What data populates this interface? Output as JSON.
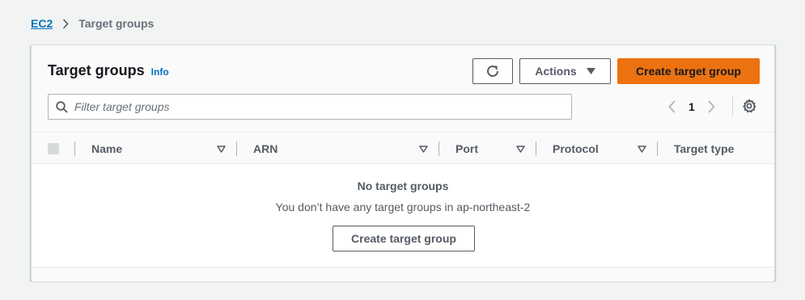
{
  "breadcrumb": {
    "root": "EC2",
    "current": "Target groups"
  },
  "header": {
    "title": "Target groups",
    "info": "Info",
    "actions_label": "Actions",
    "create_label": "Create target group"
  },
  "search": {
    "placeholder": "Filter target groups",
    "value": ""
  },
  "pagination": {
    "page": "1"
  },
  "table": {
    "columns": [
      "Name",
      "ARN",
      "Port",
      "Protocol",
      "Target type"
    ]
  },
  "empty": {
    "title": "No target groups",
    "description": "You don’t have any target groups in ap-northeast-2",
    "button_label": "Create target group"
  },
  "colors": {
    "primary": "#ec7211",
    "link": "#0073bb",
    "text": "#16191f",
    "muted": "#545b64"
  },
  "icons": {
    "refresh": "refresh-icon",
    "caret": "caret-down-icon",
    "search": "search-icon",
    "prev": "chevron-left-icon",
    "next": "chevron-right-icon",
    "settings": "gear-icon",
    "sort": "sort-down-icon"
  }
}
